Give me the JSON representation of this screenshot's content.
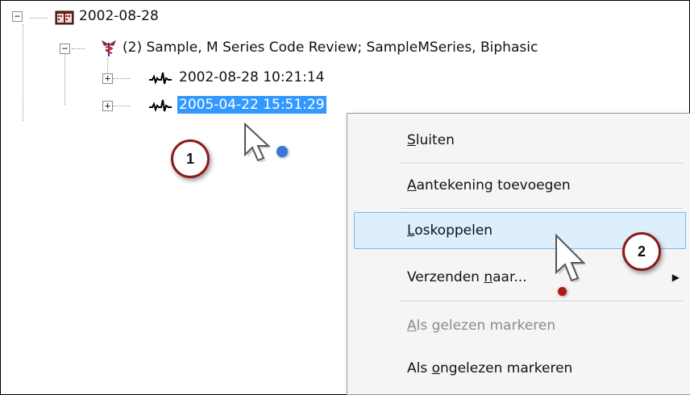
{
  "tree": {
    "root": {
      "label": "2002-08-28",
      "expander": "−",
      "icon": "calendar-icon"
    },
    "series": {
      "label": "(2) Sample, M Series Code Review; SampleMSeries, Biphasic",
      "expander": "−",
      "icon": "caduceus-icon"
    },
    "records": [
      {
        "label": "2002-08-28 10:21:14",
        "expander": "+",
        "icon": "ecg-waveform-icon",
        "selected": false
      },
      {
        "label": "2005-04-22 15:51:29",
        "expander": "+",
        "icon": "ecg-waveform-icon",
        "selected": true
      }
    ]
  },
  "context_menu": {
    "items": [
      {
        "pre": "",
        "accel": "S",
        "post": "luiten",
        "state": "normal"
      },
      {
        "pre": "",
        "accel": "A",
        "post": "antekening toevoegen",
        "state": "normal"
      },
      {
        "pre": "",
        "accel": "L",
        "post": "oskoppelen",
        "state": "hover"
      },
      {
        "pre": "Verzenden ",
        "accel": "n",
        "post": "aar...",
        "state": "normal",
        "submenu_arrow": "▶"
      },
      {
        "pre": "",
        "accel": "A",
        "post": "ls gelezen markeren",
        "state": "disabled"
      },
      {
        "pre": "Als ",
        "accel": "o",
        "post": "ngelezen markeren",
        "state": "normal"
      }
    ]
  },
  "callouts": [
    {
      "number": "1"
    },
    {
      "number": "2"
    }
  ],
  "colors": {
    "selection": "#3399ff",
    "menu_hover": "#ddeefc",
    "callout_ring": "#8b1a1a",
    "click_dot_1": "#3a78d8",
    "click_dot_2": "#b01818"
  }
}
